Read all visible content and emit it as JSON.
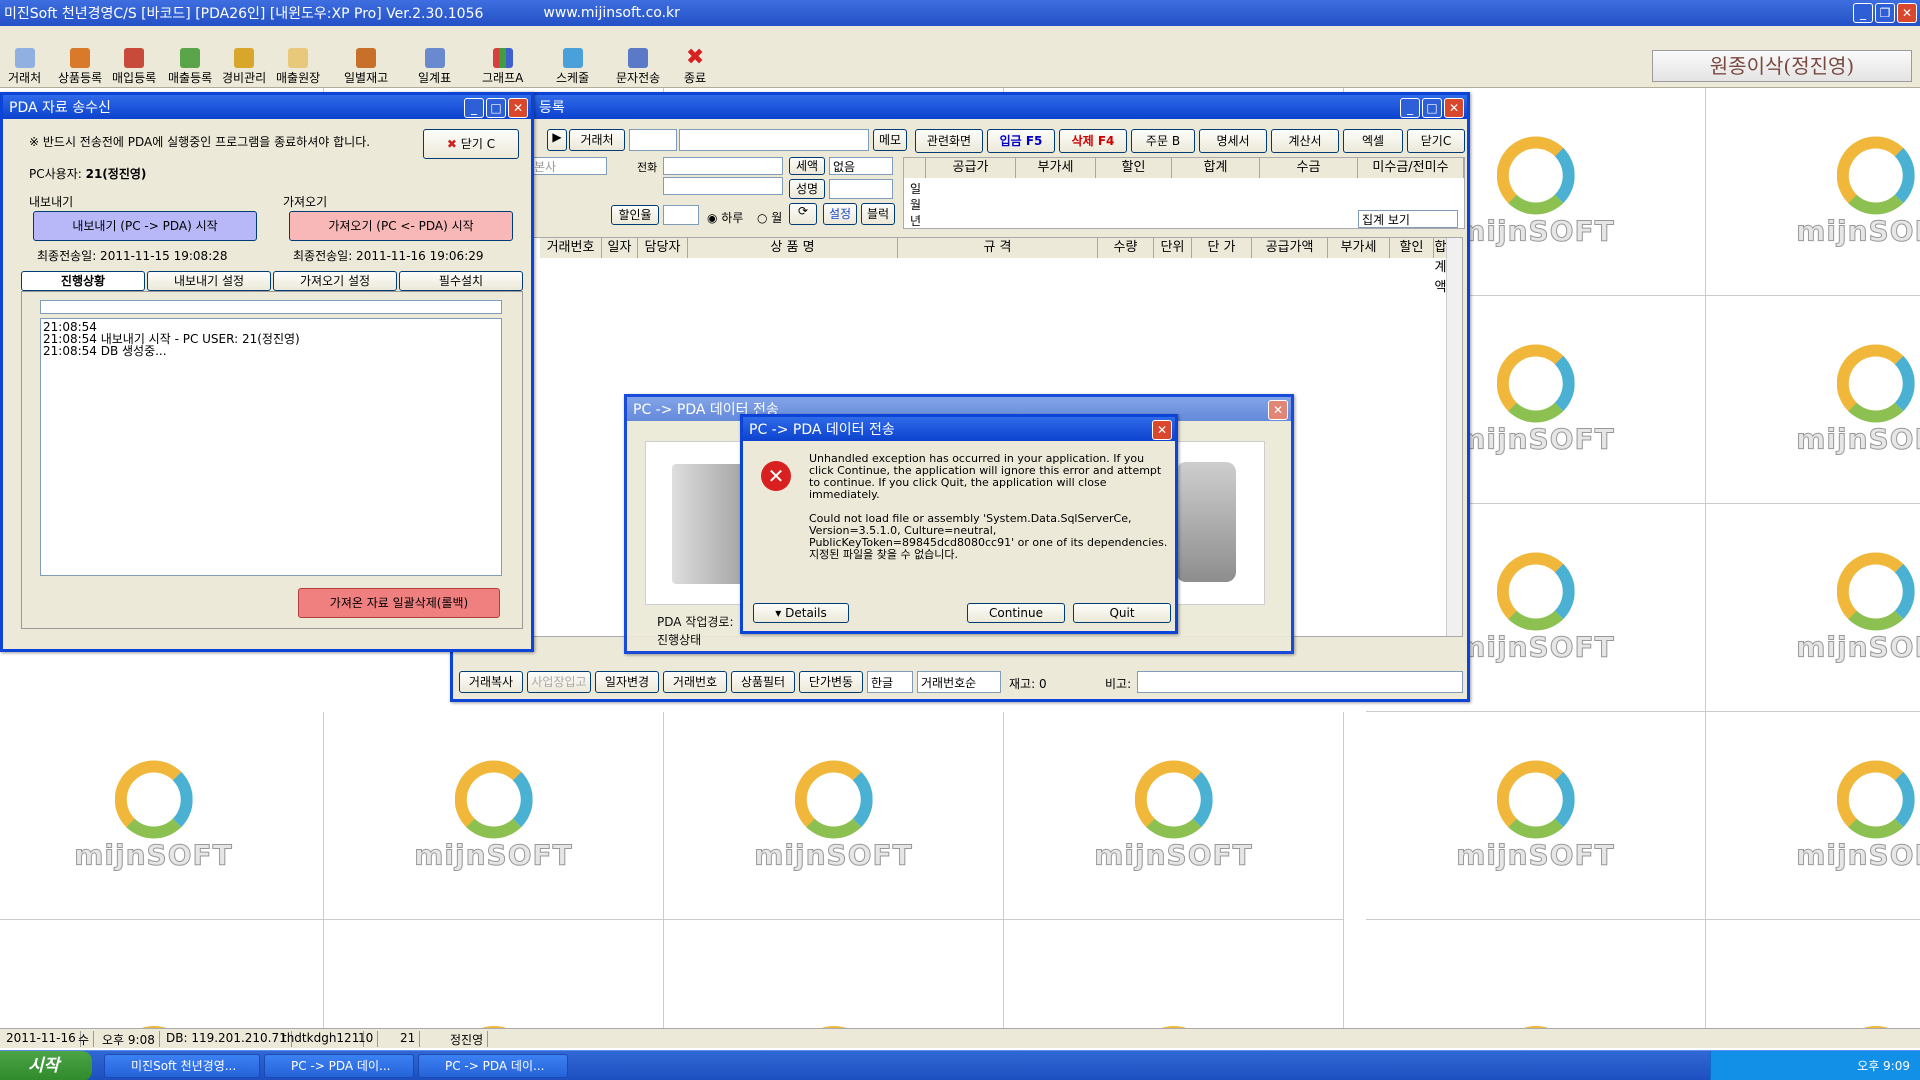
{
  "main_window": {
    "title": "미진Soft 천년경영C/S [바코드] [PDA26인] [내윈도우:XP Pro] Ver.2.30.1056",
    "url": "www.mijinsoft.co.kr",
    "user": "원종이삭(정진영)"
  },
  "toolbar": [
    "거래처",
    "상품등록",
    "매입등록",
    "매출등록",
    "경비관리",
    "매출원장",
    "일별재고",
    "일계표",
    "그래프A",
    "스케줄",
    "문자전송",
    "종료"
  ],
  "logo_text": "mijnSOFT",
  "pda_window": {
    "title": "PDA 자료 송수신",
    "notice": "※ 반드시 전송전에 PDA에 실행중인 프로그램을 종료하셔야 합니다.",
    "close": "닫기 C",
    "pc_user_label": "PC사용자:",
    "pc_user_value": "21(정진영)",
    "export_group": "내보내기",
    "import_group": "가져오기",
    "export_btn": "내보내기 (PC -> PDA) 시작",
    "import_btn": "가져오기 (PC <- PDA) 시작",
    "export_last": "최종전송일: 2011-11-15 19:08:28",
    "import_last": "최종전송일: 2011-11-16 19:06:29",
    "tabs": [
      "진행상황",
      "내보내기 설정",
      "가져오기 설정",
      "필수설치"
    ],
    "log": [
      "21:08:54",
      "21:08:54 내보내기 시작 - PC USER: 21(정진영)",
      "21:08:54 DB 생성중..."
    ],
    "delete_btn": "가져온 자료 일괄삭제(롤백)"
  },
  "sales_window": {
    "title": "등록",
    "buttons_top": [
      "관련화면",
      "입금 F5",
      "삭제 F4",
      "주문 B",
      "명세서",
      "계산서",
      "엑셀",
      "닫기C"
    ],
    "client_label": "거래처",
    "memo": "메모",
    "tax_label": "세액",
    "tax_value": "없음",
    "seal_label": "성명",
    "discount": "할인율",
    "day_radio": "하루",
    "month_radio": "월",
    "setting": "설정",
    "block": "블럭",
    "phone_label": "전화",
    "branch": "본사",
    "summary_headers": [
      "공급가",
      "부가세",
      "할인",
      "합계",
      "수금",
      "미수금/전미수"
    ],
    "summary_rows": [
      "일",
      "월",
      "년"
    ],
    "view_select": "집계 보기",
    "grid_headers": [
      "거래번호",
      "일자",
      "담당자",
      "상 품 명",
      "규 격",
      "수량",
      "단위",
      "단 가",
      "공급가액",
      "부가세",
      "할인",
      "합계액"
    ],
    "bottom_buttons": [
      "거래복사",
      "사업장입고",
      "일자변경",
      "거래번호",
      "상품필터",
      "단가변동"
    ],
    "lang_select": "한글",
    "order_select": "거래번호순",
    "stock": "재고: 0",
    "note_label": "비고:"
  },
  "transfer_window": {
    "title": "PC -> PDA 데이터 전송",
    "path_label": "PDA 작업경로:",
    "state_label": "진행상태"
  },
  "error_dialog": {
    "title": "PC -> PDA 데이터 전송",
    "message1": "Unhandled exception has occurred in your application. If you click Continue, the application will ignore this error and attempt to continue. If you click Quit, the application will close immediately.",
    "message2": "Could not load file or assembly 'System.Data.SqlServerCe, Version=3.5.1.0, Culture=neutral, PublicKeyToken=89845dcd8080cc91' or one of its dependencies. 지정된 파일을 찾을 수 없습니다.",
    "details": "Details",
    "continue": "Continue",
    "quit": "Quit"
  },
  "statusbar": [
    "2011-11-16",
    "수",
    "오후 9:08",
    "DB: 119.201.210.71",
    "thdtkdgh121",
    "10",
    "21",
    "정진영"
  ],
  "taskbar": {
    "start": "시작",
    "tasks": [
      "미진Soft 천년경영...",
      "PC -> PDA 데이...",
      "PC -> PDA 데이..."
    ],
    "clock": "오후 9:09"
  }
}
